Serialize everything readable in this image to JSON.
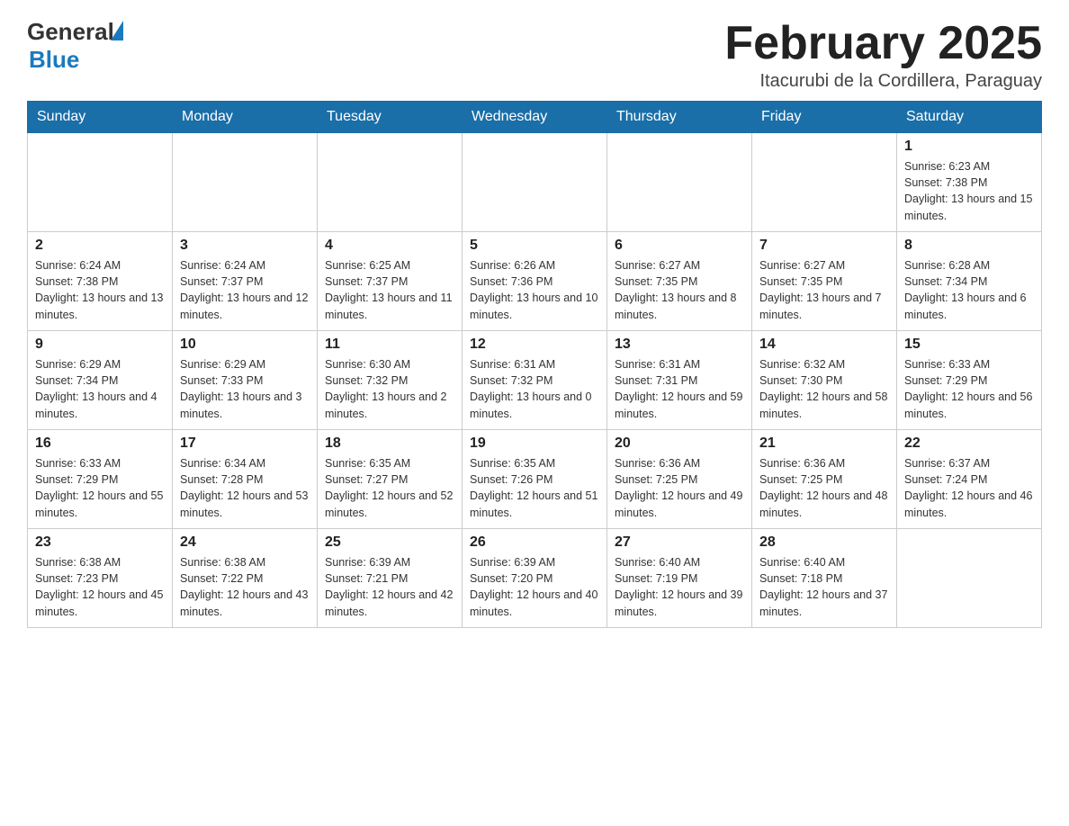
{
  "header": {
    "logo_general": "General",
    "logo_blue": "Blue",
    "month_title": "February 2025",
    "location": "Itacurubi de la Cordillera, Paraguay"
  },
  "weekdays": [
    "Sunday",
    "Monday",
    "Tuesday",
    "Wednesday",
    "Thursday",
    "Friday",
    "Saturday"
  ],
  "weeks": [
    [
      {
        "day": "",
        "info": ""
      },
      {
        "day": "",
        "info": ""
      },
      {
        "day": "",
        "info": ""
      },
      {
        "day": "",
        "info": ""
      },
      {
        "day": "",
        "info": ""
      },
      {
        "day": "",
        "info": ""
      },
      {
        "day": "1",
        "info": "Sunrise: 6:23 AM\nSunset: 7:38 PM\nDaylight: 13 hours and 15 minutes."
      }
    ],
    [
      {
        "day": "2",
        "info": "Sunrise: 6:24 AM\nSunset: 7:38 PM\nDaylight: 13 hours and 13 minutes."
      },
      {
        "day": "3",
        "info": "Sunrise: 6:24 AM\nSunset: 7:37 PM\nDaylight: 13 hours and 12 minutes."
      },
      {
        "day": "4",
        "info": "Sunrise: 6:25 AM\nSunset: 7:37 PM\nDaylight: 13 hours and 11 minutes."
      },
      {
        "day": "5",
        "info": "Sunrise: 6:26 AM\nSunset: 7:36 PM\nDaylight: 13 hours and 10 minutes."
      },
      {
        "day": "6",
        "info": "Sunrise: 6:27 AM\nSunset: 7:35 PM\nDaylight: 13 hours and 8 minutes."
      },
      {
        "day": "7",
        "info": "Sunrise: 6:27 AM\nSunset: 7:35 PM\nDaylight: 13 hours and 7 minutes."
      },
      {
        "day": "8",
        "info": "Sunrise: 6:28 AM\nSunset: 7:34 PM\nDaylight: 13 hours and 6 minutes."
      }
    ],
    [
      {
        "day": "9",
        "info": "Sunrise: 6:29 AM\nSunset: 7:34 PM\nDaylight: 13 hours and 4 minutes."
      },
      {
        "day": "10",
        "info": "Sunrise: 6:29 AM\nSunset: 7:33 PM\nDaylight: 13 hours and 3 minutes."
      },
      {
        "day": "11",
        "info": "Sunrise: 6:30 AM\nSunset: 7:32 PM\nDaylight: 13 hours and 2 minutes."
      },
      {
        "day": "12",
        "info": "Sunrise: 6:31 AM\nSunset: 7:32 PM\nDaylight: 13 hours and 0 minutes."
      },
      {
        "day": "13",
        "info": "Sunrise: 6:31 AM\nSunset: 7:31 PM\nDaylight: 12 hours and 59 minutes."
      },
      {
        "day": "14",
        "info": "Sunrise: 6:32 AM\nSunset: 7:30 PM\nDaylight: 12 hours and 58 minutes."
      },
      {
        "day": "15",
        "info": "Sunrise: 6:33 AM\nSunset: 7:29 PM\nDaylight: 12 hours and 56 minutes."
      }
    ],
    [
      {
        "day": "16",
        "info": "Sunrise: 6:33 AM\nSunset: 7:29 PM\nDaylight: 12 hours and 55 minutes."
      },
      {
        "day": "17",
        "info": "Sunrise: 6:34 AM\nSunset: 7:28 PM\nDaylight: 12 hours and 53 minutes."
      },
      {
        "day": "18",
        "info": "Sunrise: 6:35 AM\nSunset: 7:27 PM\nDaylight: 12 hours and 52 minutes."
      },
      {
        "day": "19",
        "info": "Sunrise: 6:35 AM\nSunset: 7:26 PM\nDaylight: 12 hours and 51 minutes."
      },
      {
        "day": "20",
        "info": "Sunrise: 6:36 AM\nSunset: 7:25 PM\nDaylight: 12 hours and 49 minutes."
      },
      {
        "day": "21",
        "info": "Sunrise: 6:36 AM\nSunset: 7:25 PM\nDaylight: 12 hours and 48 minutes."
      },
      {
        "day": "22",
        "info": "Sunrise: 6:37 AM\nSunset: 7:24 PM\nDaylight: 12 hours and 46 minutes."
      }
    ],
    [
      {
        "day": "23",
        "info": "Sunrise: 6:38 AM\nSunset: 7:23 PM\nDaylight: 12 hours and 45 minutes."
      },
      {
        "day": "24",
        "info": "Sunrise: 6:38 AM\nSunset: 7:22 PM\nDaylight: 12 hours and 43 minutes."
      },
      {
        "day": "25",
        "info": "Sunrise: 6:39 AM\nSunset: 7:21 PM\nDaylight: 12 hours and 42 minutes."
      },
      {
        "day": "26",
        "info": "Sunrise: 6:39 AM\nSunset: 7:20 PM\nDaylight: 12 hours and 40 minutes."
      },
      {
        "day": "27",
        "info": "Sunrise: 6:40 AM\nSunset: 7:19 PM\nDaylight: 12 hours and 39 minutes."
      },
      {
        "day": "28",
        "info": "Sunrise: 6:40 AM\nSunset: 7:18 PM\nDaylight: 12 hours and 37 minutes."
      },
      {
        "day": "",
        "info": ""
      }
    ]
  ]
}
